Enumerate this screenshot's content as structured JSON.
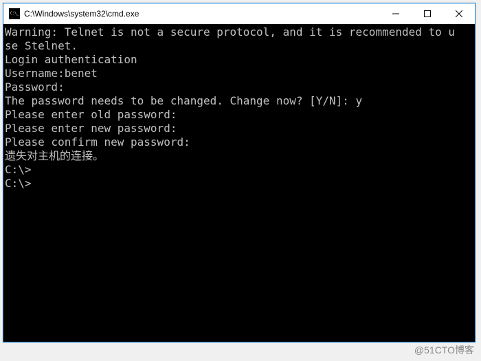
{
  "window": {
    "title": "C:\\Windows\\system32\\cmd.exe"
  },
  "terminal": {
    "lines": [
      "",
      "Warning: Telnet is not a secure protocol, and it is recommended to u",
      "se Stelnet.",
      "",
      "Login authentication",
      "",
      "",
      "Username:benet",
      "Password:",
      "The password needs to be changed. Change now? [Y/N]: y",
      "Please enter old password:",
      "Please enter new password:",
      "Please confirm new password:",
      "",
      "遗失对主机的连接。",
      "",
      "C:\\>",
      "C:\\>"
    ]
  },
  "watermark": "@51CTO博客"
}
